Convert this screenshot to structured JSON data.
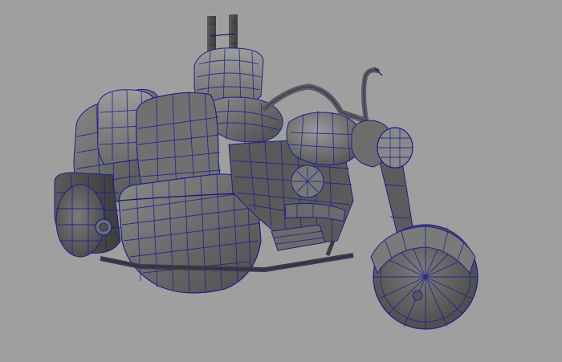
{
  "viewport": {
    "background": "#9f9f9f",
    "shading": "smooth-shade-with-wireframe",
    "wire_color": "#1e1e8c"
  },
  "model": {
    "parts": [
      "sidecar-body",
      "sidecar-seat",
      "sidecar-windshield",
      "sidecar-wheel",
      "sidecar-light",
      "motorcycle-seat",
      "sissy-bar",
      "fuel-tank",
      "handlebars",
      "headlight",
      "front-fork",
      "front-wheel",
      "front-fender",
      "engine",
      "footboard",
      "exhaust",
      "sidecar-frame-bar"
    ]
  }
}
